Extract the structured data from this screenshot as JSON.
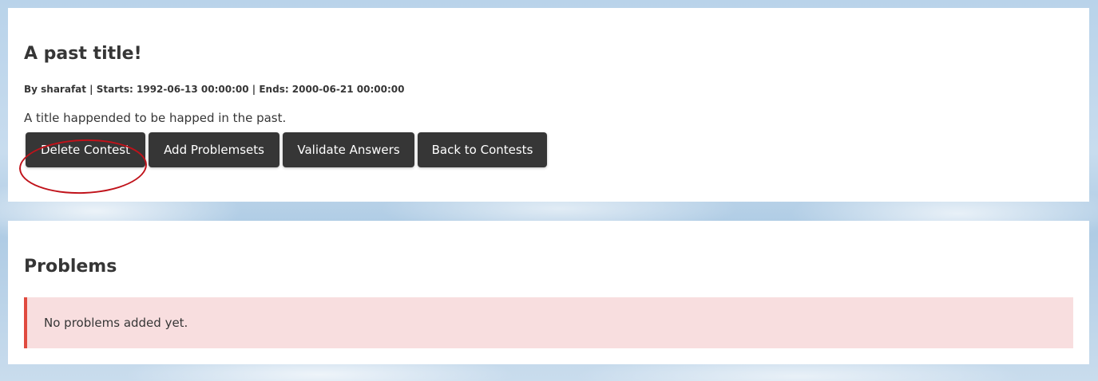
{
  "contest": {
    "title": "A past title!",
    "meta": "By sharafat | Starts: 1992-06-13 00:00:00 | Ends: 2000-06-21 00:00:00",
    "description": "A title happended to be happed in the past.",
    "buttons": {
      "delete": "Delete Contest",
      "add_problemsets": "Add Problemsets",
      "validate_answers": "Validate Answers",
      "back_to_contests": "Back to Contests"
    }
  },
  "problems": {
    "title": "Problems",
    "empty_message": "No problems added yet."
  },
  "colors": {
    "button_bg": "#363636",
    "notice_bg": "#f8dedf",
    "notice_border": "#e04a3f",
    "highlight": "#c0121a"
  }
}
